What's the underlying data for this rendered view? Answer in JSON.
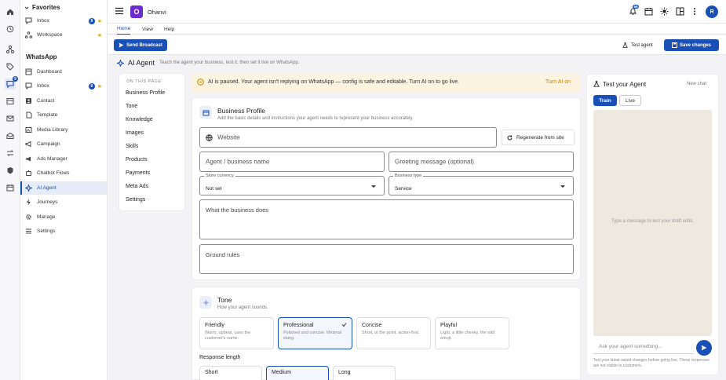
{
  "rail": {
    "inbox_badge": "9"
  },
  "sidebar": {
    "favorites_label": "Favorites",
    "favorites": [
      {
        "label": "Inbox",
        "count": "9"
      },
      {
        "label": "Workspace"
      }
    ],
    "section_label": "WhatsApp",
    "items": [
      {
        "label": "Dashboard"
      },
      {
        "label": "Inbox",
        "count": "9"
      },
      {
        "label": "Contact"
      },
      {
        "label": "Template"
      },
      {
        "label": "Media Library"
      },
      {
        "label": "Campaign"
      },
      {
        "label": "Ads Manager"
      },
      {
        "label": "Chatbot Flows"
      },
      {
        "label": "AI Agent"
      },
      {
        "label": "Journeys"
      },
      {
        "label": "Manage"
      },
      {
        "label": "Settings"
      }
    ]
  },
  "topbar": {
    "app_logo_letter": "O",
    "app_name": "Ohanvi",
    "notif_count": "99",
    "avatar_letter": "R"
  },
  "tabs": [
    "Home",
    "View",
    "Help"
  ],
  "toolbar": {
    "send_broadcast": "Send Broadcast",
    "test_agent": "Test agent",
    "save_changes": "Save changes"
  },
  "page": {
    "title": "AI Agent",
    "subtitle": "Teach the agent your business, test it, then set it live on WhatsApp."
  },
  "on_this_page": {
    "heading": "ON THIS PAGE",
    "links": [
      "Business Profile",
      "Tone",
      "Knowledge",
      "Images",
      "Skills",
      "Products",
      "Payments",
      "Meta Ads",
      "Settings"
    ]
  },
  "alert": {
    "text": "AI is paused. Your agent isn't replying on WhatsApp — config is safe and editable. Turn AI on to go live.",
    "action": "Turn AI on"
  },
  "business_profile": {
    "title": "Business Profile",
    "description": "Add the basic details and instructions your agent needs to represent your business accurately.",
    "website_placeholder": "Website",
    "regenerate_label": "Regenerate from site",
    "agent_name_placeholder": "Agent / business name",
    "greeting_placeholder": "Greeting message (optional)",
    "currency_label": "Store currency",
    "currency_value": "Not set",
    "business_type_label": "Business type",
    "business_type_value": "Service",
    "what_business_placeholder": "What the business does",
    "ground_rules_placeholder": "Ground rules"
  },
  "tone": {
    "title": "Tone",
    "description": "How your agent sounds.",
    "options": [
      {
        "title": "Friendly",
        "desc": "Warm, upbeat, uses the customer's name."
      },
      {
        "title": "Professional",
        "desc": "Polished and concise. Minimal slang.",
        "selected": true
      },
      {
        "title": "Concise",
        "desc": "Short, to the point, action-first."
      },
      {
        "title": "Playful",
        "desc": "Light, a little cheeky, the odd emoji."
      }
    ],
    "response_length_label": "Response length",
    "lengths": [
      "Short",
      "Medium",
      "Long"
    ]
  },
  "test_panel": {
    "title": "Test your Agent",
    "new_chat": "New chat",
    "modes": [
      "Train",
      "Live"
    ],
    "empty_text": "Type a message to test your draft edits.",
    "input_placeholder": "Ask your agent something...",
    "footnote": "Test your latest saved changes before going live. These responses are not visible to customers."
  },
  "colors": {
    "accent": "#1a4fb5",
    "warning_bg": "#fdf3e1",
    "warning_text": "#c47f00",
    "chat_bg": "#ede9df"
  }
}
